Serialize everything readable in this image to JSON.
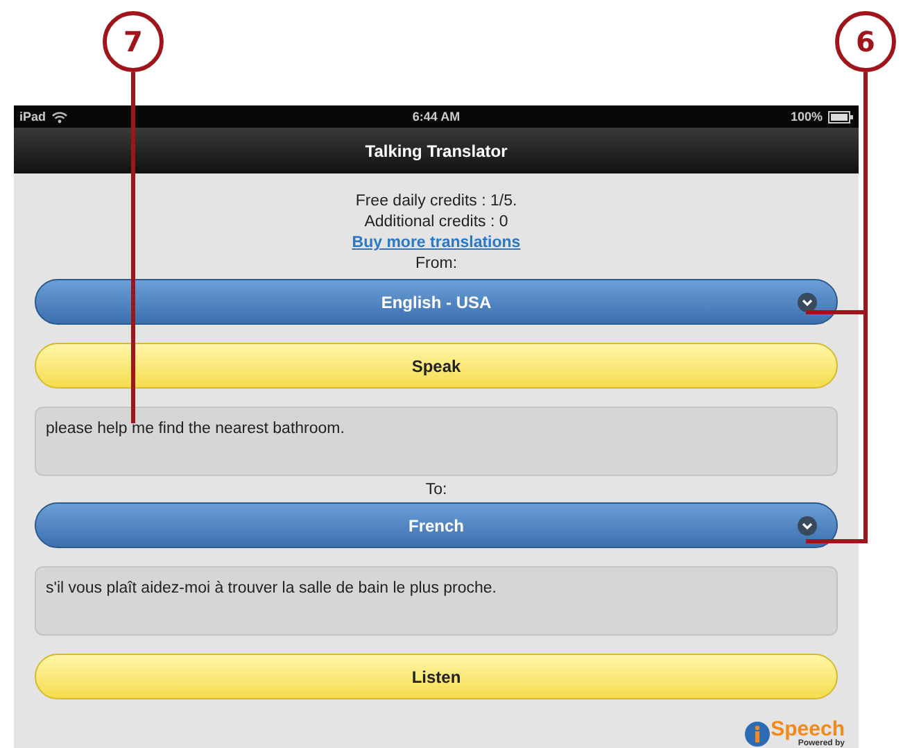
{
  "callouts": [
    {
      "label": "7"
    },
    {
      "label": "6"
    }
  ],
  "status_bar": {
    "device": "iPad",
    "time": "6:44 AM",
    "battery": "100%"
  },
  "nav_bar": {
    "title": "Talking Translator"
  },
  "credits": {
    "free": "Free daily credits : 1/5.",
    "additional": "Additional credits : 0",
    "buy_link": "Buy more translations"
  },
  "from": {
    "label": "From:",
    "language": "English - USA"
  },
  "speak_button": "Speak",
  "source_text": "please help me find the nearest bathroom.",
  "to": {
    "label": "To:",
    "language": "French"
  },
  "translation_text": "s'il vous plaît aidez-moi à trouver la salle de bain le plus proche.",
  "listen_button": "Listen",
  "logo": {
    "name": "Speech",
    "tagline": "Powered by"
  }
}
